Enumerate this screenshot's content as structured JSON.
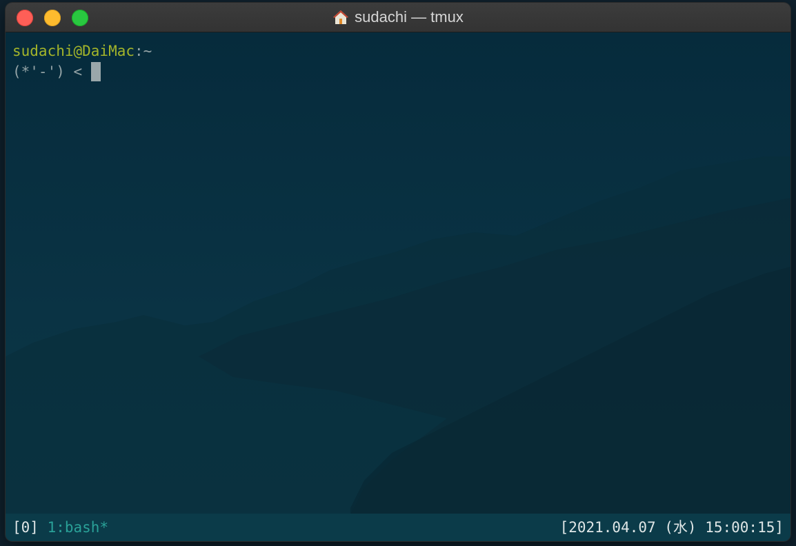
{
  "window": {
    "title": "sudachi — tmux",
    "title_icon": "home-icon",
    "buttons": [
      "close",
      "minimize",
      "maximize"
    ]
  },
  "terminal": {
    "prompt_user_host": "sudachi@DaiMac",
    "prompt_sep": ":",
    "prompt_path": "~",
    "prompt_face": "(*'-') < "
  },
  "tmux": {
    "session": "[0]",
    "window": "1:bash*",
    "datetime": "[2021.04.07 (水) 15:00:15]"
  },
  "colors": {
    "user_host": "#a4b52a",
    "active_window": "#2aa198",
    "statusbar_bg": "#0b3b49",
    "terminal_bg": "#083040"
  }
}
